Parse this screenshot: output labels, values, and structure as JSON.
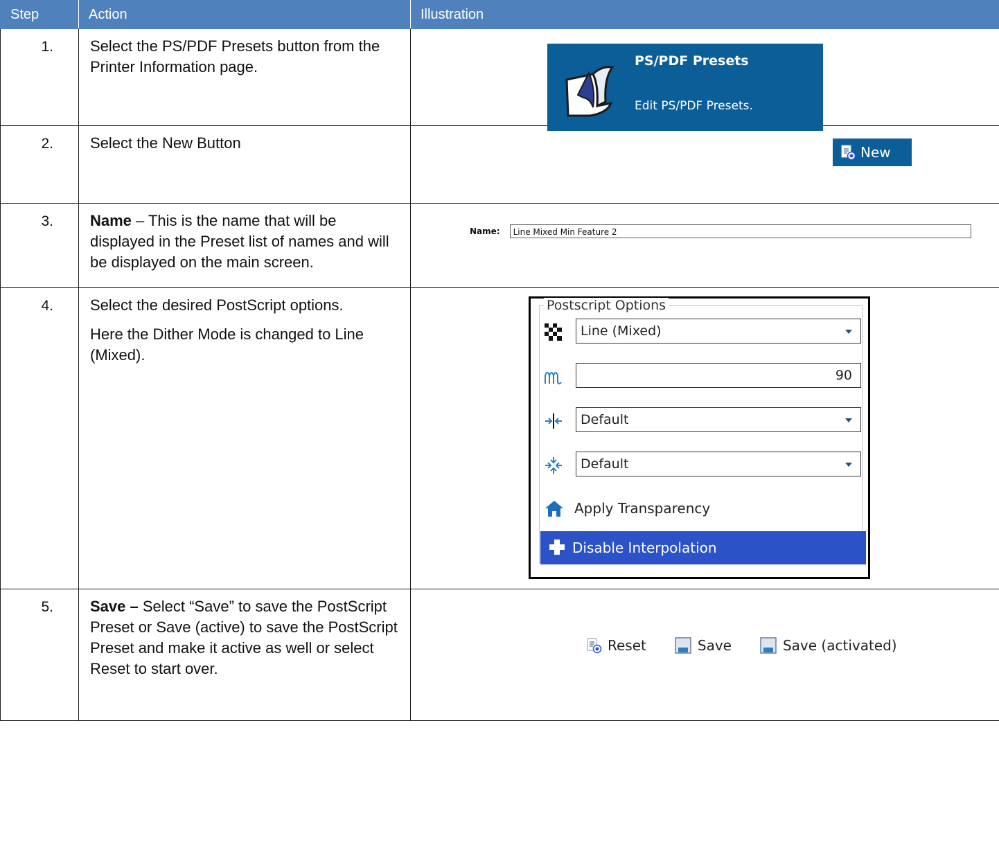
{
  "header": {
    "col_step": "Step",
    "col_action": "Action",
    "col_illustration": "Illustration"
  },
  "rows": [
    {
      "step": "1.",
      "action": "Select the PS/PDF Presets button from the Printer Information page."
    },
    {
      "step": "2.",
      "action": "Select the New Button"
    },
    {
      "step": "3.",
      "action_bold": "Name",
      "action": " – This is the name that will be displayed in the Preset list of names and will be displayed on the main screen."
    },
    {
      "step": "4.",
      "action": "Select the desired PostScript options.",
      "action_2": "Here the Dither Mode is changed to Line (Mixed)."
    },
    {
      "step": "5.",
      "action_bold": "Save –",
      "action": " Select “Save” to save the PostScript Preset or Save (active) to save the PostScript Preset and make it active as well or select Reset to start over."
    }
  ],
  "tile": {
    "title": "PS/PDF Presets",
    "subtitle": "Edit PS/PDF Presets.",
    "color": "#0b5e98"
  },
  "new_button": {
    "label": "New"
  },
  "name_field": {
    "label": "Name:",
    "value": "Line Mixed Min Feature 2"
  },
  "postscript": {
    "legend": "Postscript Options",
    "dither_mode": "Line (Mixed)",
    "frequency": "90",
    "option3": "Default",
    "option4": "Default",
    "apply_transparency": "Apply Transparency",
    "disable_interpolation": "Disable Interpolation",
    "active_color": "#2b52c7"
  },
  "save_bar": {
    "reset": "Reset",
    "save": "Save",
    "save_activated": "Save (activated)"
  },
  "header_color": "#4f81bd"
}
